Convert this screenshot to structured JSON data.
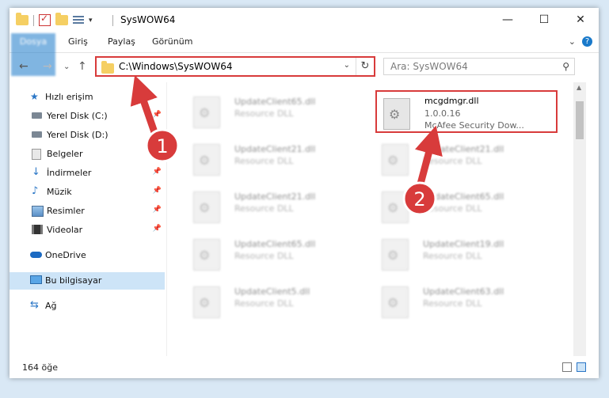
{
  "window": {
    "title": "SysWOW64",
    "controls": {
      "minimize": "—",
      "maximize": "☐",
      "close": "✕"
    }
  },
  "ribbon": {
    "tabs": [
      "Dosya",
      "Giriş",
      "Paylaş",
      "Görünüm"
    ],
    "expand_glyph": "⌄",
    "help_glyph": "?"
  },
  "navigation": {
    "back": "←",
    "forward": "→",
    "recent": "⌄",
    "up": "↑",
    "address": "C:\\Windows\\SysWOW64",
    "address_dropdown": "⌄",
    "refresh": "↻",
    "search_placeholder": "Ara: SysWOW64",
    "search_glyph": "⚲"
  },
  "sidebar": {
    "items": [
      {
        "label": "Hızlı erişim",
        "icon": "star-icon",
        "glyph": "★"
      },
      {
        "label": "Yerel Disk (C:)",
        "icon": "drive-icon",
        "pinned": true
      },
      {
        "label": "Yerel Disk (D:)",
        "icon": "drive-icon"
      },
      {
        "label": "Belgeler",
        "icon": "document-icon"
      },
      {
        "label": "İndirmeler",
        "icon": "download-icon",
        "glyph": "↓",
        "pinned": true
      },
      {
        "label": "Müzik",
        "icon": "music-icon",
        "glyph": "♪",
        "pinned": true
      },
      {
        "label": "Resimler",
        "icon": "pictures-icon",
        "pinned": true
      },
      {
        "label": "Videolar",
        "icon": "videos-icon",
        "pinned": true
      },
      {
        "label": "OneDrive",
        "icon": "cloud-icon"
      },
      {
        "label": "Bu bilgisayar",
        "icon": "computer-icon",
        "selected": true
      },
      {
        "label": "Ağ",
        "icon": "network-icon",
        "glyph": "⇆"
      }
    ],
    "pin_glyph": "📌"
  },
  "files": [
    {
      "name": "UpdateClient65.dll",
      "desc": "Resource DLL",
      "col": 0,
      "row": 0
    },
    {
      "name": "mcgdmgr.dll",
      "desc": "1.0.0.16",
      "desc2": "McAfee Security Dow...",
      "col": 1,
      "row": 0,
      "highlight": true
    },
    {
      "name": "UpdateClient21.dll",
      "desc": "Resource DLL",
      "col": 0,
      "row": 1
    },
    {
      "name": "UpdateClient21.dll",
      "desc": "Resource DLL",
      "col": 1,
      "row": 1
    },
    {
      "name": "UpdateClient21.dll",
      "desc": "Resource DLL",
      "col": 0,
      "row": 2
    },
    {
      "name": "UpdateClient65.dll",
      "desc": "Resource DLL",
      "col": 1,
      "row": 2
    },
    {
      "name": "UpdateClient65.dll",
      "desc": "Resource DLL",
      "col": 0,
      "row": 3
    },
    {
      "name": "UpdateClient19.dll",
      "desc": "Resource DLL",
      "col": 1,
      "row": 3
    },
    {
      "name": "UpdateClient5.dll",
      "desc": "Resource DLL",
      "col": 0,
      "row": 4
    },
    {
      "name": "UpdateClient63.dll",
      "desc": "Resource DLL",
      "col": 1,
      "row": 4
    }
  ],
  "status": {
    "count": "164 öğe"
  },
  "callouts": [
    {
      "number": "1"
    },
    {
      "number": "2"
    }
  ],
  "colors": {
    "accent": "#1979ca",
    "callout": "#d83b3b",
    "selection": "#cde4f7"
  }
}
